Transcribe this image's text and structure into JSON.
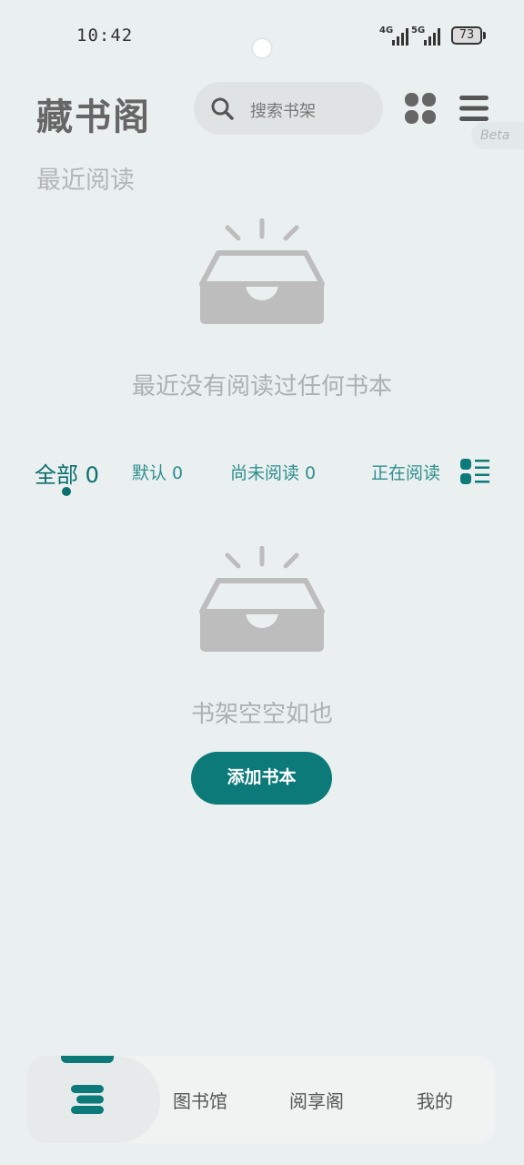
{
  "status_bar": {
    "time": "10:42",
    "signal_1": "4G",
    "signal_2": "5G",
    "battery": "73"
  },
  "header": {
    "app_title": "藏书阁",
    "search_placeholder": "搜索书架",
    "beta_label": "Beta"
  },
  "recent": {
    "title": "最近阅读",
    "empty_text": "最近没有阅读过任何书本"
  },
  "tabs": [
    {
      "label": "全部 0"
    },
    {
      "label": "默认 0"
    },
    {
      "label": "尚未阅读 0"
    },
    {
      "label": "正在阅读"
    }
  ],
  "shelf": {
    "empty_text": "书架空空如也",
    "add_button": "添加书本"
  },
  "bottom_nav": {
    "items": [
      {
        "label": "图书馆"
      },
      {
        "label": "阅享阁"
      },
      {
        "label": "我的"
      }
    ]
  },
  "colors": {
    "accent": "#0d7a7a",
    "background": "#eaf0f0",
    "empty_gray": "#bdbdbd"
  }
}
